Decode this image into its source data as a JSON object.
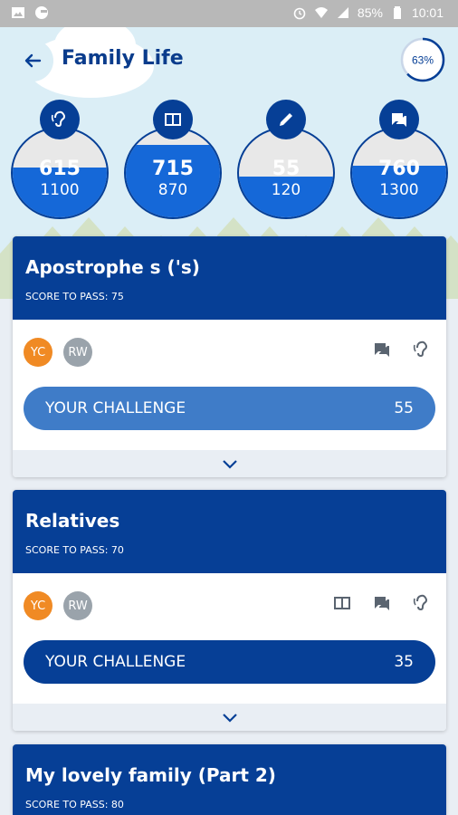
{
  "status_bar": {
    "battery": "85%",
    "time": "10:01"
  },
  "header": {
    "title": "Family Life",
    "progress": "63%",
    "progress_value": 0.63
  },
  "skills": [
    {
      "icon": "ear-icon",
      "score": "615",
      "target": "1100",
      "fill": 0.56
    },
    {
      "icon": "book-icon",
      "score": "715",
      "target": "870",
      "fill": 0.82
    },
    {
      "icon": "pencil-icon",
      "score": "55",
      "target": "120",
      "fill": 0.46
    },
    {
      "icon": "chat-icon",
      "score": "760",
      "target": "1300",
      "fill": 0.58
    }
  ],
  "cards": [
    {
      "title": "Apostrophe s ('s)",
      "score_to_pass": "SCORE TO PASS: 75",
      "avatars": [
        "YC",
        "RW"
      ],
      "icons": [
        "chat-icon",
        "ear-icon"
      ],
      "challenge_label": "YOUR CHALLENGE",
      "challenge_score": "55",
      "challenge_color": "#3f7cc8"
    },
    {
      "title": "Relatives",
      "score_to_pass": "SCORE TO PASS: 70",
      "avatars": [
        "YC",
        "RW"
      ],
      "icons": [
        "book-icon",
        "chat-icon",
        "ear-icon"
      ],
      "challenge_label": "YOUR CHALLENGE",
      "challenge_score": "35",
      "challenge_color": "#063f96"
    },
    {
      "title": "My lovely family (Part 2)",
      "score_to_pass": "SCORE TO PASS: 80"
    }
  ],
  "colors": {
    "primary": "#063f96",
    "accent": "#1568d8",
    "avatar_yc": "#f08a24",
    "avatar_rw": "#9aa3ab"
  }
}
